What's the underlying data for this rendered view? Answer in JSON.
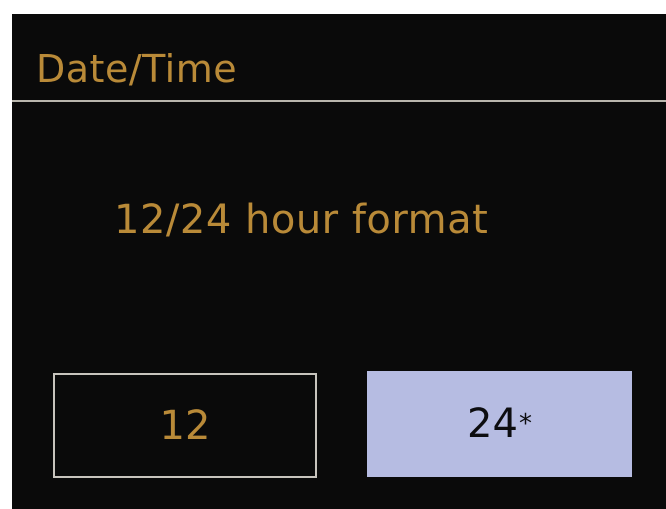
{
  "header": {
    "title": "Date/Time"
  },
  "prompt": {
    "text": "12/24 hour format"
  },
  "options": {
    "twelve": {
      "label": "12",
      "selected": false
    },
    "twentyfour": {
      "label": "24",
      "marker": "*",
      "selected": true
    }
  },
  "colors": {
    "text_amber": "#b98a38",
    "background": "#0a0a0a",
    "selected_fill": "#b6bce2",
    "rule": "#b9b6ad"
  }
}
